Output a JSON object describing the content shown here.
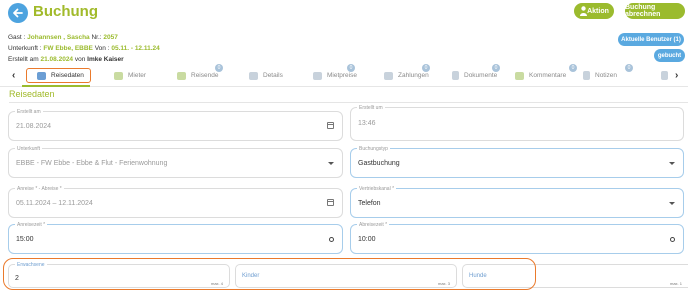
{
  "header": {
    "title": "Buchung",
    "aktion_label": "Aktion",
    "buchung_abrechnen_label": "Buchung abrechnen"
  },
  "info": {
    "gast_label": "Gast : ",
    "gast_name": "Johannsen , Sascha",
    "nr_label": " Nr.: ",
    "nr": "2057",
    "unterkunft_label": "Unterkunft : ",
    "unterkunft": "FW Ebbe, EBBE",
    "von_label": " Von : ",
    "von": "05.11. - 12.11.24",
    "erstellt_label": "Erstellt am ",
    "erstellt_date": "21.08.2024",
    "von2_label": " von ",
    "erstellt_by": "Imke Kaiser"
  },
  "status": {
    "aktuelle_benutzer": "Aktuelle Benutzer (1)",
    "gebucht": "gebucht"
  },
  "tabs": [
    {
      "label": "Reisedaten",
      "badge": ""
    },
    {
      "label": "Mieter",
      "badge": ""
    },
    {
      "label": "Reisende",
      "badge": "0"
    },
    {
      "label": "Details",
      "badge": ""
    },
    {
      "label": "Mietpreise",
      "badge": "0"
    },
    {
      "label": "Zahlungen",
      "badge": "0"
    },
    {
      "label": "Dokumente",
      "badge": "0"
    },
    {
      "label": "Kommentare",
      "badge": "0"
    },
    {
      "label": "Notizen",
      "badge": "0"
    }
  ],
  "section": {
    "title": "Reisedaten"
  },
  "fields": {
    "erstellt_am": {
      "label": "Erstellt am",
      "value": "21.08.2024"
    },
    "erstellt_um": {
      "label": "Erstellt um",
      "value": "13:46"
    },
    "unterkunft": {
      "label": "Unterkunft",
      "value": "EBBE - FW Ebbe - Ebbe & Flut - Ferienwohnung"
    },
    "buchungstyp": {
      "label": "Buchungstyp",
      "value": "Gastbuchung"
    },
    "anreise_abreise": {
      "label": "Anreise * - Abreise *",
      "value": "05.11.2024 – 12.11.2024"
    },
    "vertriebskanal": {
      "label": "Vertriebskanal *",
      "value": "Telefon"
    },
    "anreisezeit": {
      "label": "Anreisezeit *",
      "value": "15:00"
    },
    "abreisezeit": {
      "label": "Abreisezeit *",
      "value": "10:00"
    }
  },
  "counts": {
    "erwachsene": {
      "label": "Erwachsene",
      "value": "2",
      "max": "max. 4"
    },
    "kinder": {
      "placeholder": "Kinder",
      "max": "max. 3"
    },
    "hunde": {
      "placeholder": "Hunde",
      "max": "max. 1"
    }
  },
  "colors": {
    "brand_green": "#a1ba2a",
    "accent_blue": "#5aa9e0",
    "highlight_orange": "#ea7a2c"
  },
  "icons": {
    "back": "arrow-left-icon",
    "aktion": "person-icon",
    "calendar": "calendar-icon",
    "clock": "clock-icon",
    "dropdown": "chevron-down-icon"
  }
}
